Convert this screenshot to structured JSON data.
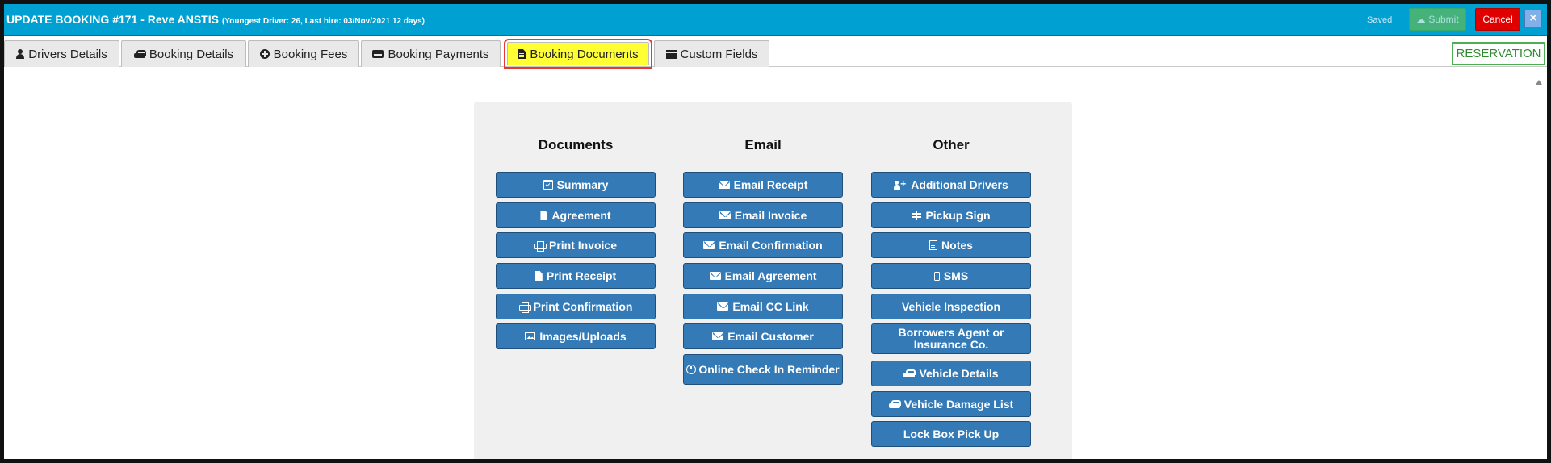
{
  "window": {
    "title": "UPDATE BOOKING #171  - Reve ANSTIS",
    "subtitle": "(Youngest Driver: 26, Last hire: 03/Nov/2021 12 days)",
    "saved_label": "Saved",
    "submit_label": "Submit",
    "cancel_label": "Cancel",
    "close_label": "×"
  },
  "tabs": [
    {
      "label": "Drivers Details",
      "icon": "user-icon"
    },
    {
      "label": "Booking Details",
      "icon": "car-icon"
    },
    {
      "label": "Booking Fees",
      "icon": "plus-circle-icon"
    },
    {
      "label": "Booking Payments",
      "icon": "credit-card-icon"
    },
    {
      "label": "Booking Documents",
      "icon": "file-text-icon",
      "active": true
    },
    {
      "label": "Custom Fields",
      "icon": "list-icon"
    }
  ],
  "status_badge": "RESERVATION",
  "columns": {
    "documents": {
      "heading": "Documents",
      "buttons": [
        {
          "label": "Summary",
          "icon": "calendar-check-icon"
        },
        {
          "label": "Agreement",
          "icon": "file-icon"
        },
        {
          "label": "Print Invoice",
          "icon": "print-icon"
        },
        {
          "label": "Print Receipt",
          "icon": "file-icon"
        },
        {
          "label": "Print Confirmation",
          "icon": "print-icon"
        },
        {
          "label": "Images/Uploads",
          "icon": "image-icon"
        }
      ]
    },
    "email": {
      "heading": "Email",
      "buttons": [
        {
          "label": "Email Receipt",
          "icon": "envelope-icon"
        },
        {
          "label": "Email Invoice",
          "icon": "envelope-icon"
        },
        {
          "label": "Email Confirmation",
          "icon": "envelope-icon"
        },
        {
          "label": "Email Agreement",
          "icon": "envelope-icon"
        },
        {
          "label": "Email CC Link",
          "icon": "envelope-icon"
        },
        {
          "label": "Email Customer",
          "icon": "envelope-icon"
        },
        {
          "label": "Online Check In Reminder",
          "icon": "clock-icon"
        }
      ]
    },
    "other": {
      "heading": "Other",
      "buttons": [
        {
          "label": "Additional Drivers",
          "icon": "user-plus-icon"
        },
        {
          "label": "Pickup Sign",
          "icon": "sign-icon"
        },
        {
          "label": "Notes",
          "icon": "file-text-icon"
        },
        {
          "label": "SMS",
          "icon": "mobile-icon"
        },
        {
          "label": "Vehicle Inspection",
          "icon": ""
        },
        {
          "label": "Borrowers Agent or Insurance Co.",
          "icon": ""
        },
        {
          "label": "Vehicle Details",
          "icon": "car-icon"
        },
        {
          "label": "Vehicle Damage List",
          "icon": "car-icon"
        },
        {
          "label": "Lock Box Pick Up",
          "icon": ""
        }
      ]
    }
  },
  "colors": {
    "header": "#00a0d2",
    "button": "#337ab7",
    "active_tab": "#ffff33",
    "highlight": "#e53935",
    "badge": "#4caf50"
  }
}
